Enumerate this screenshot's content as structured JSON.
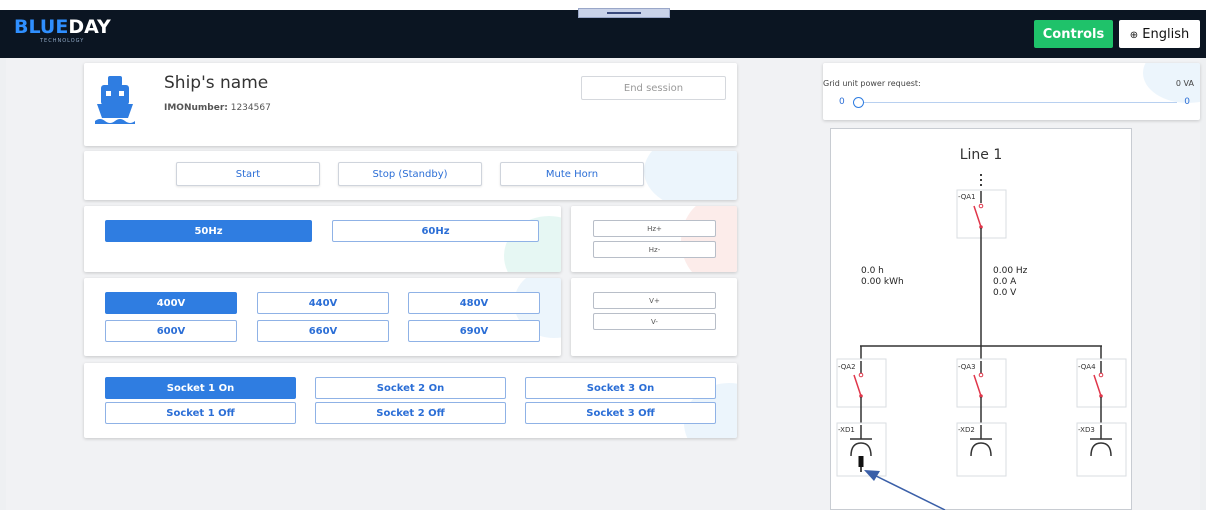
{
  "header": {
    "logo_part1": "BLUE",
    "logo_part2": "DAY",
    "logo_sub": "TECHNOLOGY",
    "controls_label": "Controls",
    "language_label": "English",
    "language_icon": "globe-icon"
  },
  "ship": {
    "name": "Ship's name",
    "imo_label": "IMONumber:",
    "imo_value": "1234567",
    "end_session_label": "End session"
  },
  "commands": {
    "start": "Start",
    "stop": "Stop (Standby)",
    "mute": "Mute Horn"
  },
  "frequency": {
    "options": [
      "50Hz",
      "60Hz"
    ],
    "selected": "50Hz",
    "up": "Hz+",
    "down": "Hz-"
  },
  "voltage": {
    "options": [
      "400V",
      "440V",
      "480V",
      "600V",
      "660V",
      "690V"
    ],
    "selected": "400V",
    "up": "V+",
    "down": "V-"
  },
  "sockets": {
    "on": [
      "Socket 1 On",
      "Socket 2 On",
      "Socket 3 On"
    ],
    "off": [
      "Socket 1 Off",
      "Socket 2 Off",
      "Socket 3 Off"
    ],
    "selected": "Socket 1 On"
  },
  "grid": {
    "label": "Grid unit power request:",
    "value": "0 VA",
    "slider_min": "0",
    "slider_max": "0",
    "slider_level": 0
  },
  "diagram": {
    "title": "Line 1",
    "main_breaker": "-QA1",
    "time": "0.0 h",
    "energy": "0.00 kWh",
    "frequency": "0.00 Hz",
    "current": "0.0 A",
    "voltage": "0.0 V",
    "breakers": [
      "-QA2",
      "-QA3",
      "-QA4"
    ],
    "sockets": [
      "-XD1",
      "-XD2",
      "-XD3"
    ]
  },
  "colors": {
    "accent": "#2f7de1",
    "controls_green": "#1fc26a",
    "header_bg": "#0b1522",
    "breaker_red": "#e0364a"
  }
}
